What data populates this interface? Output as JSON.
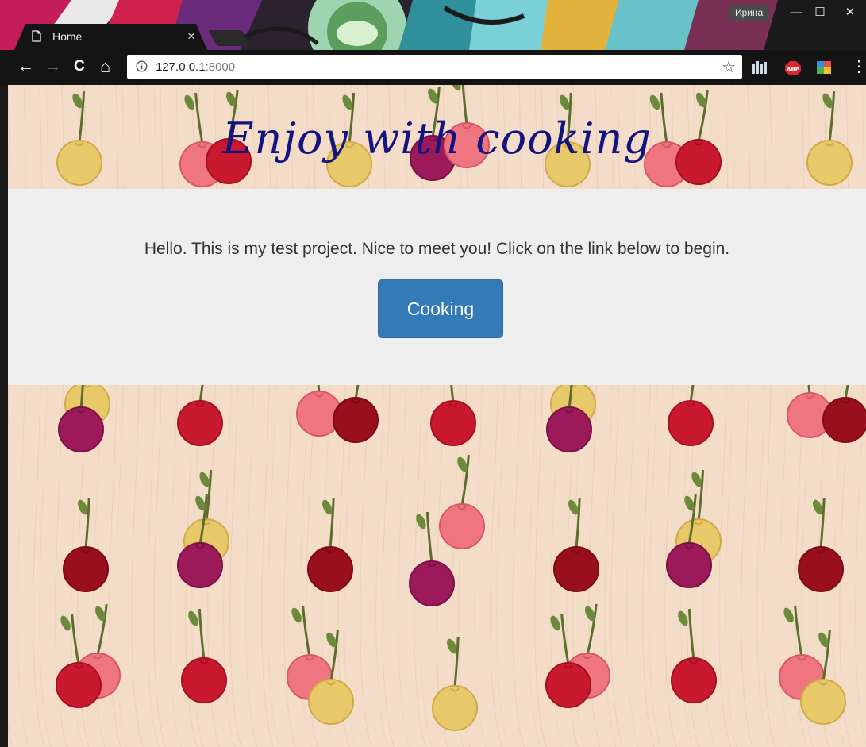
{
  "browser": {
    "tab": {
      "title": "Home",
      "close_symbol": "×"
    },
    "toolbar": {
      "back_symbol": "←",
      "forward_symbol": "→",
      "reload_symbol": "C",
      "home_symbol": "⌂",
      "url_host": "127.0.0.1",
      "url_port": ":8000",
      "bookmark_symbol": "☆",
      "menu_symbol": "⋮"
    },
    "extensions": [
      {
        "name": "bars-extension-icon"
      },
      {
        "name": "adblock-extension-icon",
        "label": "ABP"
      },
      {
        "name": "colorful-extension-icon"
      }
    ],
    "window": {
      "user": "Ирина",
      "minimize_symbol": "—",
      "maximize_symbol": "☐",
      "close_symbol": "✕"
    }
  },
  "page": {
    "header_title": "Enjoy with cooking",
    "intro_text": "Hello. This is my test project. Nice to meet you! Click on the link below to begin.",
    "button_label": "Cooking"
  },
  "colors": {
    "button_bg": "#337ab7",
    "jumbotron_bg": "#eeeeee",
    "title_color": "#141480",
    "background": "#f3ddc9"
  }
}
